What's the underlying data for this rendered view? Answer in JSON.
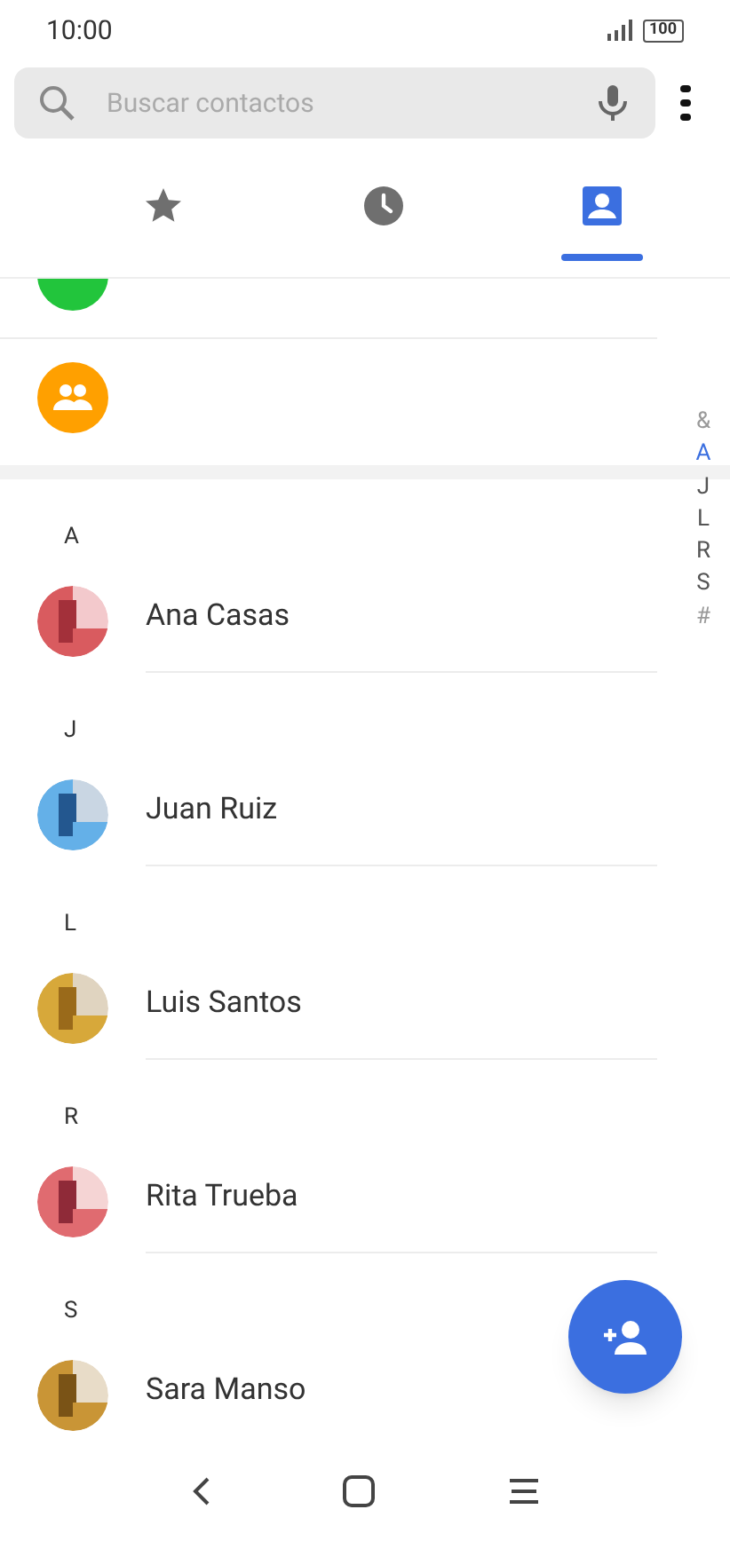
{
  "status_bar": {
    "time": "10:00",
    "battery": "100"
  },
  "search": {
    "placeholder": "Buscar contactos"
  },
  "tabs": [
    {
      "kind": "favorites",
      "selected": false
    },
    {
      "kind": "recents",
      "selected": false
    },
    {
      "kind": "contacts",
      "selected": true
    }
  ],
  "top_items": [
    {
      "kind": "contact"
    },
    {
      "kind": "groups"
    }
  ],
  "sections": [
    {
      "letter": "A",
      "contacts": [
        {
          "name": "Ana Casas"
        }
      ]
    },
    {
      "letter": "J",
      "contacts": [
        {
          "name": "Juan Ruiz"
        }
      ]
    },
    {
      "letter": "L",
      "contacts": [
        {
          "name": "Luis Santos"
        }
      ]
    },
    {
      "letter": "R",
      "contacts": [
        {
          "name": "Rita Trueba"
        }
      ]
    },
    {
      "letter": "S",
      "contacts": [
        {
          "name": "Sara Manso"
        }
      ]
    }
  ],
  "index": [
    {
      "label": "&",
      "selected": false
    },
    {
      "label": "A",
      "selected": true
    },
    {
      "label": "J",
      "selected": false
    },
    {
      "label": "L",
      "selected": false
    },
    {
      "label": "R",
      "selected": false
    },
    {
      "label": "S",
      "selected": false
    },
    {
      "label": "#",
      "selected": false
    }
  ]
}
